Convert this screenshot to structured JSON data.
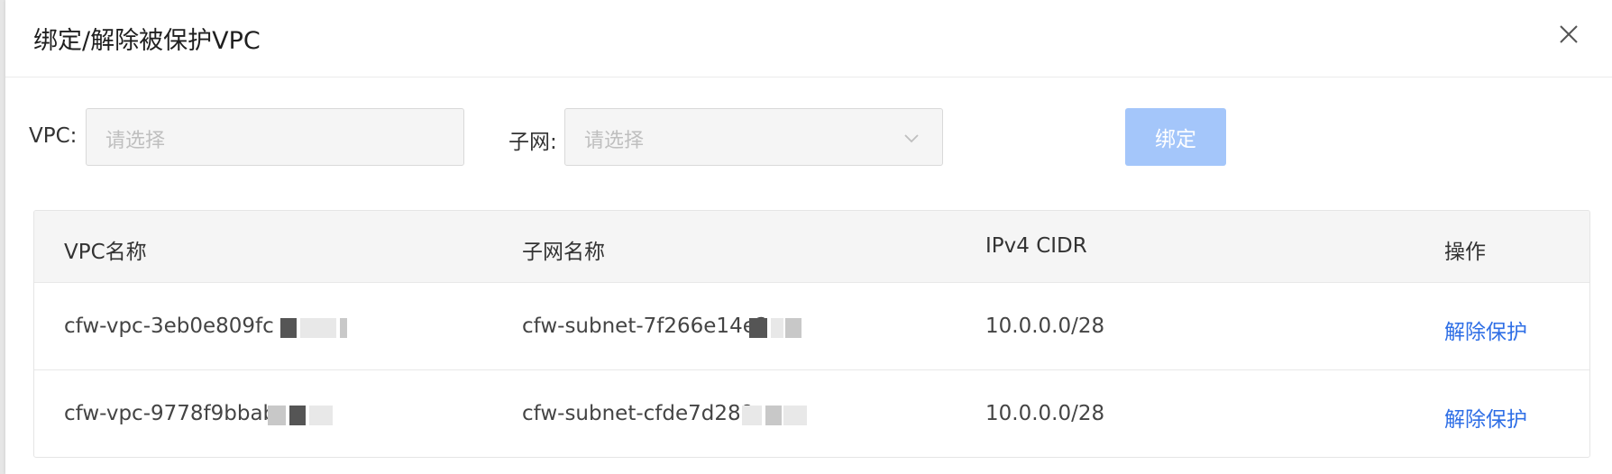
{
  "dialog": {
    "title": "绑定/解除被保护VPC",
    "close_icon": "close-icon"
  },
  "form": {
    "vpc_label": "VPC:",
    "vpc_placeholder": "请选择",
    "subnet_label": "子网:",
    "subnet_placeholder": "请选择",
    "bind_button": "绑定",
    "bind_button_color": "#a4c6fa"
  },
  "table": {
    "columns": [
      "VPC名称",
      "子网名称",
      "IPv4 CIDR",
      "操作"
    ],
    "rows": [
      {
        "vpc_name": "cfw-vpc-3eb0e809fc",
        "subnet_name": "cfw-subnet-7f266e14e2",
        "cidr": "10.0.0.0/28",
        "action": "解除保护"
      },
      {
        "vpc_name": "cfw-vpc-9778f9bbab",
        "subnet_name": "cfw-subnet-cfde7d289",
        "cidr": "10.0.0.0/28",
        "action": "解除保护"
      }
    ]
  },
  "colors": {
    "link": "#2f6fe6",
    "header_bg": "#f5f5f5"
  }
}
